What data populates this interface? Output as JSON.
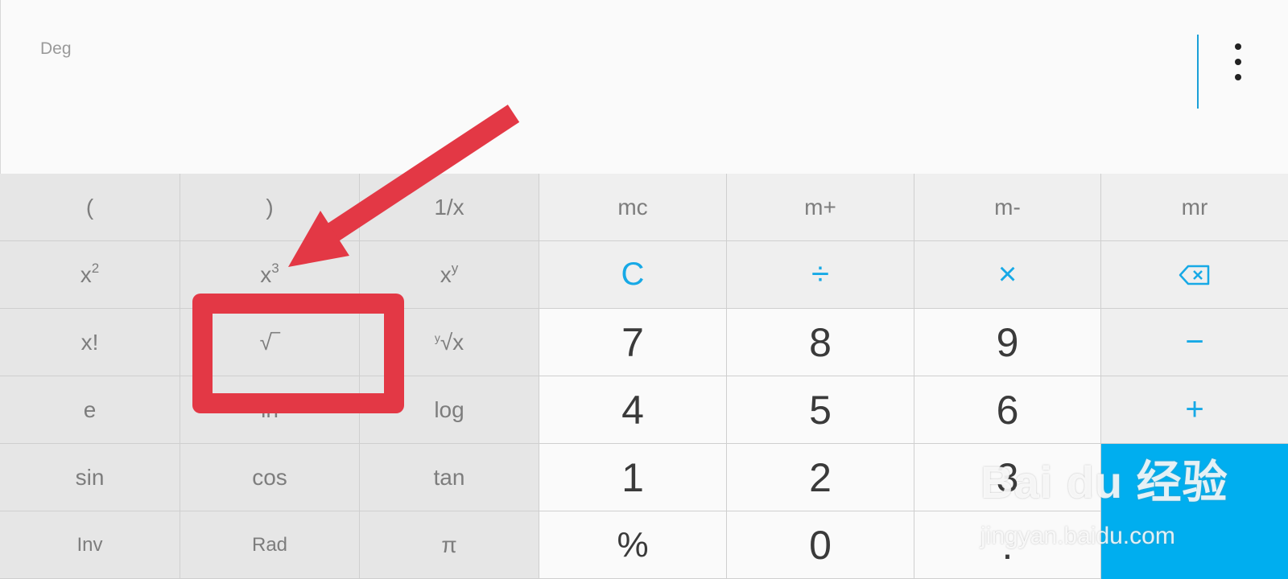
{
  "display": {
    "angle_mode": "Deg"
  },
  "menu": {
    "icon": "more-vert-icon"
  },
  "keys": {
    "scientific": [
      {
        "label": "("
      },
      {
        "label": ")"
      },
      {
        "label": "1/x"
      },
      {
        "base": "x",
        "sup": "2"
      },
      {
        "base": "x",
        "sup": "3"
      },
      {
        "base": "x",
        "sup": "y"
      },
      {
        "label": "x!"
      },
      {
        "label": "√‾"
      },
      {
        "sup": "y",
        "base": "√x"
      },
      {
        "label": "e"
      },
      {
        "label": "ln"
      },
      {
        "label": "log"
      },
      {
        "label": "sin"
      },
      {
        "label": "cos"
      },
      {
        "label": "tan"
      },
      {
        "label": "Inv"
      },
      {
        "label": "Rad"
      },
      {
        "label": "π"
      }
    ],
    "memory": [
      "mc",
      "m+",
      "m-",
      "mr"
    ],
    "operators": {
      "clear": "C",
      "divide": "÷",
      "multiply": "×",
      "backspace": "⌫",
      "minus": "−",
      "plus": "+"
    },
    "digits": {
      "d7": "7",
      "d8": "8",
      "d9": "9",
      "d4": "4",
      "d5": "5",
      "d6": "6",
      "d1": "1",
      "d2": "2",
      "d3": "3",
      "percent": "%",
      "d0": "0",
      "dot": "."
    }
  },
  "annotation": {
    "color": "#e33845"
  },
  "watermark": {
    "brand": "Bai du 经验",
    "url": "jingyan.baidu.com"
  },
  "colors": {
    "accent": "#17a9e6",
    "equals_bg": "#00aeef",
    "annotation": "#e33845"
  }
}
